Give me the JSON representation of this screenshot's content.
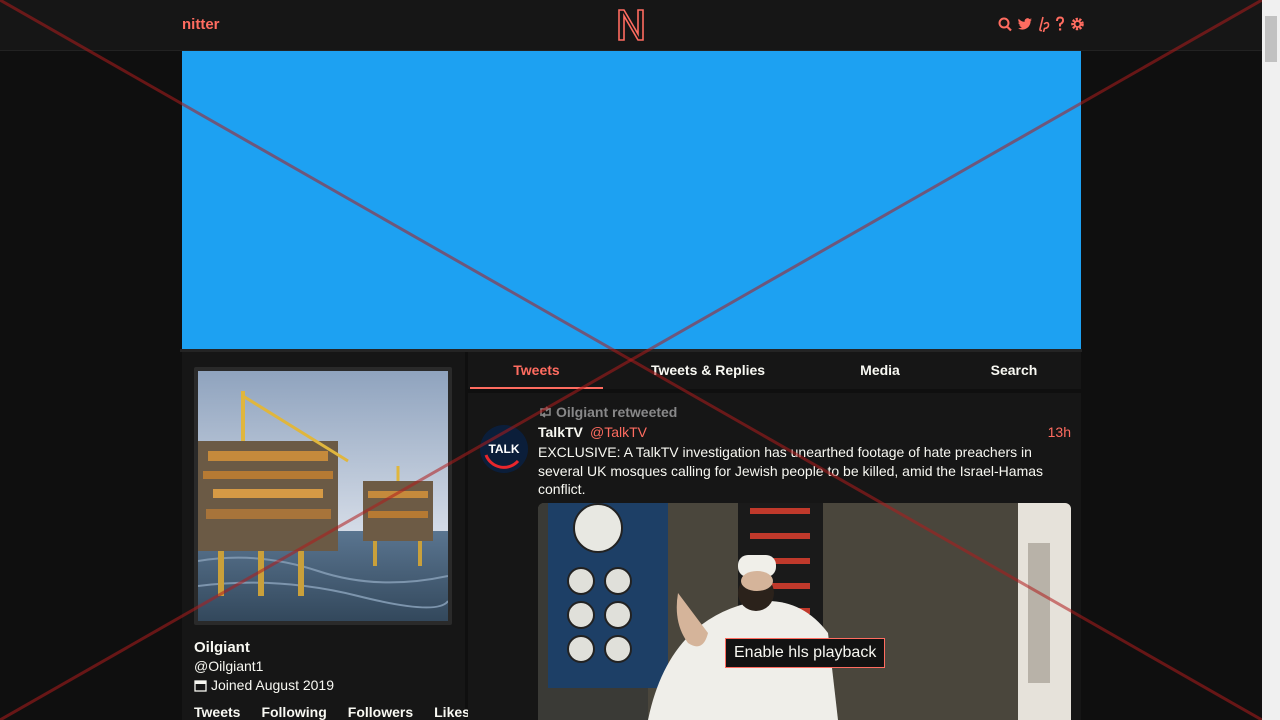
{
  "nav": {
    "brand": "nitter",
    "icons": [
      "search-icon",
      "twitter-icon",
      "liberapay-icon",
      "help-icon",
      "settings-icon"
    ]
  },
  "colors": {
    "accent": "#ff6c60",
    "banner": "#1da1f2",
    "background": "#0f0f0f",
    "panel": "#161616"
  },
  "profile": {
    "name": "Oilgiant",
    "handle": "@Oilgiant1",
    "joined": "Joined August 2019",
    "stats": {
      "tweets": "Tweets",
      "following": "Following",
      "followers": "Followers",
      "likes": "Likes"
    }
  },
  "tabs": [
    {
      "label": "Tweets",
      "active": true
    },
    {
      "label": "Tweets & Replies",
      "active": false
    },
    {
      "label": "Media",
      "active": false
    },
    {
      "label": "Search",
      "active": false
    }
  ],
  "tweet": {
    "retweet_label": "Oilgiant retweeted",
    "author_name": "TalkTV",
    "author_handle": "@TalkTV",
    "time": "13h",
    "text": "EXCLUSIVE: A TalkTV investigation has unearthed footage of hate preachers in several UK mosques calling for Jewish people to be killed, amid the Israel-Hamas conflict.",
    "avatar_text": "TALK",
    "media_button": "Enable hls playback"
  }
}
